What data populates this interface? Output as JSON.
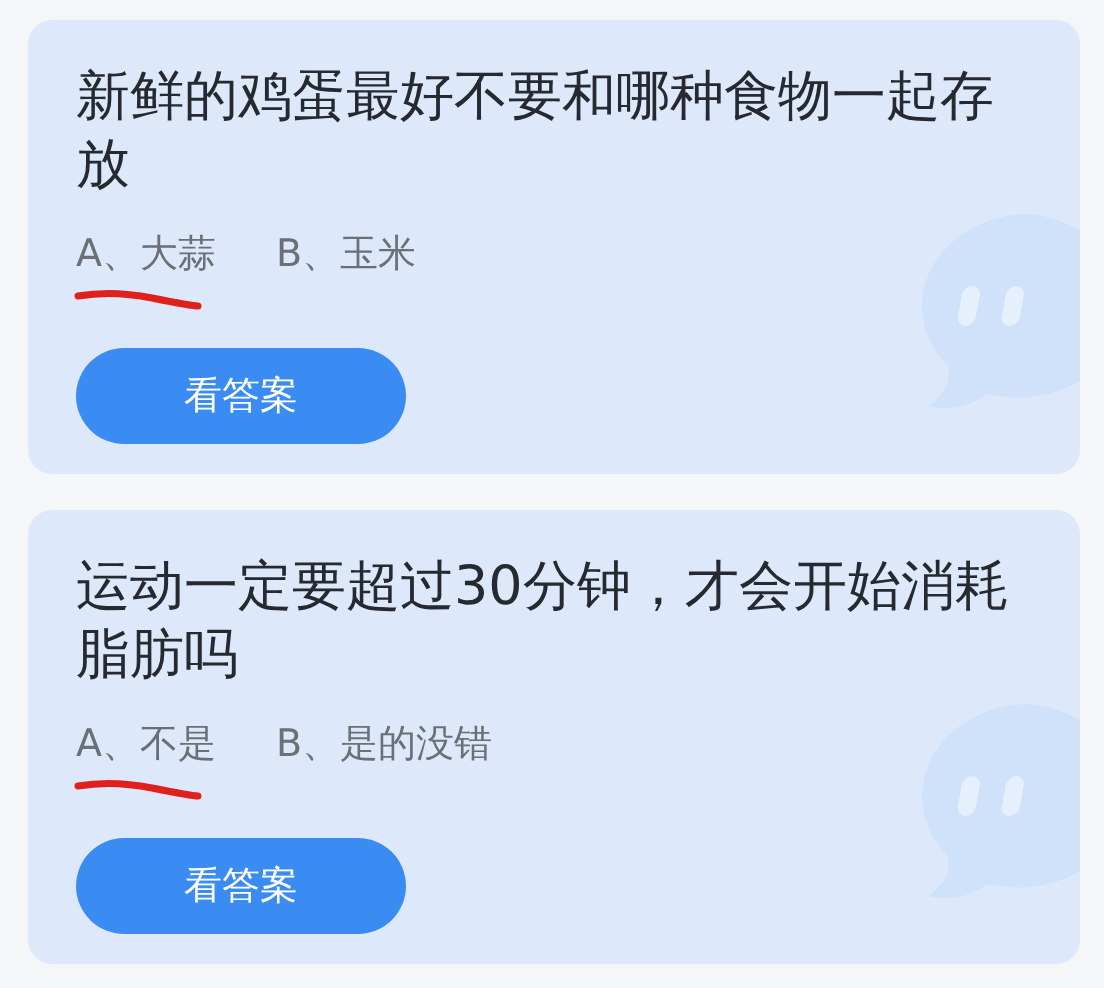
{
  "cards": [
    {
      "question": "新鲜的鸡蛋最好不要和哪种食物一起存放",
      "options": [
        {
          "text": "A、大蒜",
          "underlined": true
        },
        {
          "text": "B、玉米",
          "underlined": false
        }
      ],
      "button": "看答案"
    },
    {
      "question": "运动一定要超过30分钟，才会开始消耗脂肪吗",
      "options": [
        {
          "text": "A、不是",
          "underlined": true
        },
        {
          "text": "B、是的没错",
          "underlined": false
        }
      ],
      "button": "看答案"
    }
  ]
}
